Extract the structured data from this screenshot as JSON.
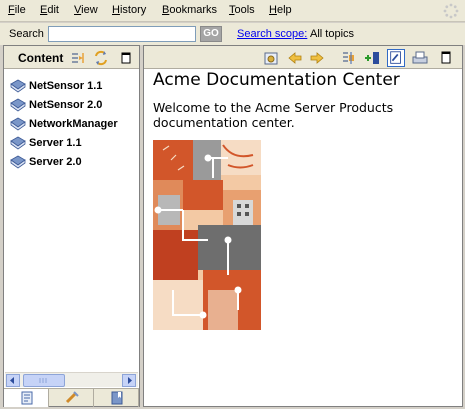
{
  "menu": {
    "items": [
      {
        "key": "F",
        "rest": "ile"
      },
      {
        "key": "E",
        "rest": "dit"
      },
      {
        "key": "V",
        "rest": "iew"
      },
      {
        "key": "H",
        "rest": "istory"
      },
      {
        "key": "B",
        "rest": "ookmarks"
      },
      {
        "key": "T",
        "rest": "ools"
      },
      {
        "key": "H",
        "rest": "elp"
      }
    ]
  },
  "search": {
    "label": "Search",
    "value": "",
    "go_label": "GO",
    "scope_link": "Search scope:",
    "scope_value": "All topics"
  },
  "sidebar": {
    "title": "Content",
    "items": [
      {
        "label": "NetSensor 1.1"
      },
      {
        "label": "NetSensor 2.0"
      },
      {
        "label": "NetworkManager"
      },
      {
        "label": "Server 1.1"
      },
      {
        "label": "Server 2.0"
      }
    ]
  },
  "main": {
    "title": "Acme Documentation Center",
    "welcome": "Welcome to the Acme Server Products documentation center."
  },
  "colors": {
    "link": "#0000ee",
    "go_button": "#a5a5a5",
    "art_orange": "#d2562a",
    "art_peach": "#f3c9a4",
    "art_gray": "#6e6e6e"
  }
}
